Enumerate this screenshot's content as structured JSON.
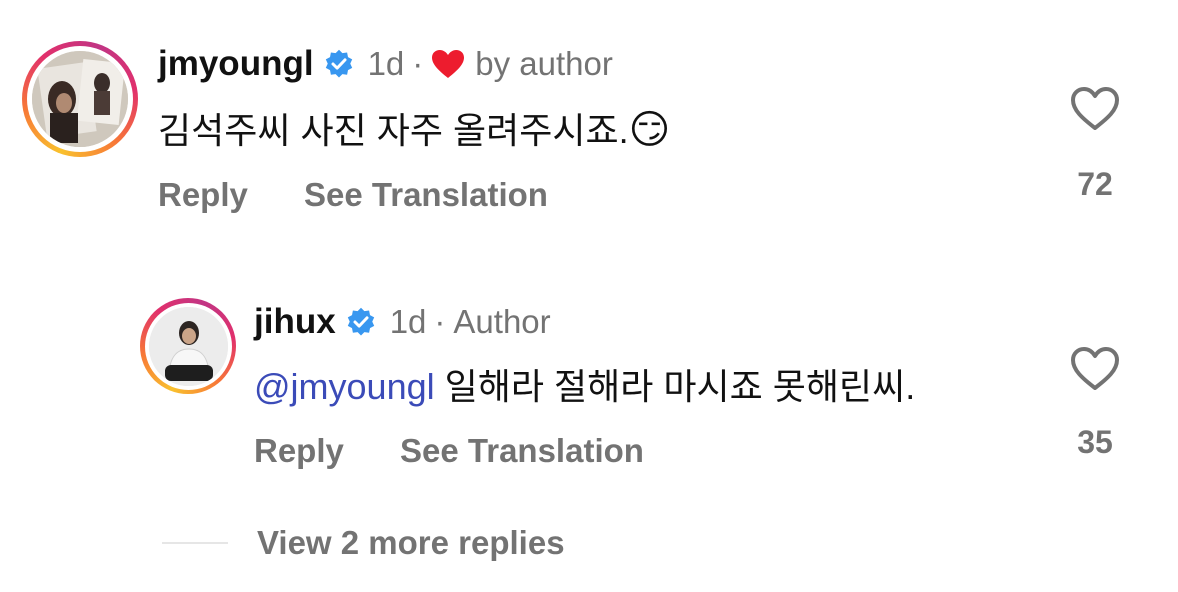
{
  "comments": [
    {
      "username": "jmyoungl",
      "time": "1d",
      "badge_text": "by author",
      "text": "김석주씨 사진 자주 올려주시죠.",
      "emoji": "😏",
      "reply_label": "Reply",
      "translate_label": "See Translation",
      "likes": "72"
    },
    {
      "username": "jihux",
      "time": "1d",
      "badge_text": "Author",
      "mention": "@jmyoungl",
      "text": "일해라 절해라 마시죠 못해린씨.",
      "reply_label": "Reply",
      "translate_label": "See Translation",
      "likes": "35"
    }
  ],
  "view_more": "View 2 more replies",
  "colors": {
    "verified": "#3897f0",
    "heart_red": "#ed1c2e",
    "mention": "#3b4bb8",
    "muted": "#737373"
  },
  "icons": {
    "verified": "verified-badge-icon",
    "liked_by_author": "red-heart-icon",
    "like": "heart-outline-icon"
  }
}
